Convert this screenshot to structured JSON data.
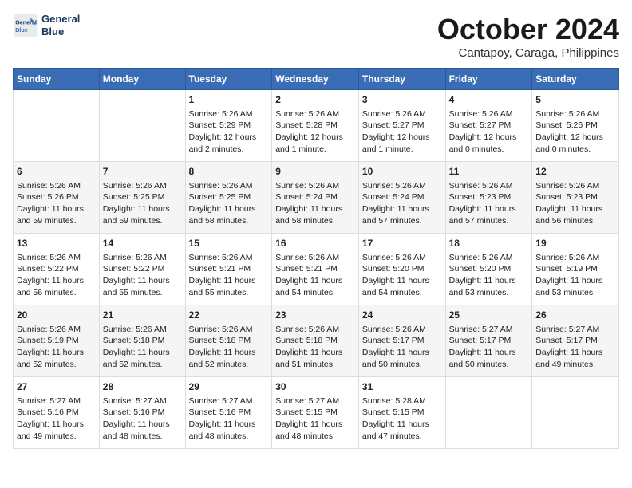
{
  "header": {
    "logo_line1": "General",
    "logo_line2": "Blue",
    "month_title": "October 2024",
    "location": "Cantapoy, Caraga, Philippines"
  },
  "days_of_week": [
    "Sunday",
    "Monday",
    "Tuesday",
    "Wednesday",
    "Thursday",
    "Friday",
    "Saturday"
  ],
  "weeks": [
    [
      {
        "day": "",
        "content": ""
      },
      {
        "day": "",
        "content": ""
      },
      {
        "day": "1",
        "content": "Sunrise: 5:26 AM\nSunset: 5:29 PM\nDaylight: 12 hours\nand 2 minutes."
      },
      {
        "day": "2",
        "content": "Sunrise: 5:26 AM\nSunset: 5:28 PM\nDaylight: 12 hours\nand 1 minute."
      },
      {
        "day": "3",
        "content": "Sunrise: 5:26 AM\nSunset: 5:27 PM\nDaylight: 12 hours\nand 1 minute."
      },
      {
        "day": "4",
        "content": "Sunrise: 5:26 AM\nSunset: 5:27 PM\nDaylight: 12 hours\nand 0 minutes."
      },
      {
        "day": "5",
        "content": "Sunrise: 5:26 AM\nSunset: 5:26 PM\nDaylight: 12 hours\nand 0 minutes."
      }
    ],
    [
      {
        "day": "6",
        "content": "Sunrise: 5:26 AM\nSunset: 5:26 PM\nDaylight: 11 hours\nand 59 minutes."
      },
      {
        "day": "7",
        "content": "Sunrise: 5:26 AM\nSunset: 5:25 PM\nDaylight: 11 hours\nand 59 minutes."
      },
      {
        "day": "8",
        "content": "Sunrise: 5:26 AM\nSunset: 5:25 PM\nDaylight: 11 hours\nand 58 minutes."
      },
      {
        "day": "9",
        "content": "Sunrise: 5:26 AM\nSunset: 5:24 PM\nDaylight: 11 hours\nand 58 minutes."
      },
      {
        "day": "10",
        "content": "Sunrise: 5:26 AM\nSunset: 5:24 PM\nDaylight: 11 hours\nand 57 minutes."
      },
      {
        "day": "11",
        "content": "Sunrise: 5:26 AM\nSunset: 5:23 PM\nDaylight: 11 hours\nand 57 minutes."
      },
      {
        "day": "12",
        "content": "Sunrise: 5:26 AM\nSunset: 5:23 PM\nDaylight: 11 hours\nand 56 minutes."
      }
    ],
    [
      {
        "day": "13",
        "content": "Sunrise: 5:26 AM\nSunset: 5:22 PM\nDaylight: 11 hours\nand 56 minutes."
      },
      {
        "day": "14",
        "content": "Sunrise: 5:26 AM\nSunset: 5:22 PM\nDaylight: 11 hours\nand 55 minutes."
      },
      {
        "day": "15",
        "content": "Sunrise: 5:26 AM\nSunset: 5:21 PM\nDaylight: 11 hours\nand 55 minutes."
      },
      {
        "day": "16",
        "content": "Sunrise: 5:26 AM\nSunset: 5:21 PM\nDaylight: 11 hours\nand 54 minutes."
      },
      {
        "day": "17",
        "content": "Sunrise: 5:26 AM\nSunset: 5:20 PM\nDaylight: 11 hours\nand 54 minutes."
      },
      {
        "day": "18",
        "content": "Sunrise: 5:26 AM\nSunset: 5:20 PM\nDaylight: 11 hours\nand 53 minutes."
      },
      {
        "day": "19",
        "content": "Sunrise: 5:26 AM\nSunset: 5:19 PM\nDaylight: 11 hours\nand 53 minutes."
      }
    ],
    [
      {
        "day": "20",
        "content": "Sunrise: 5:26 AM\nSunset: 5:19 PM\nDaylight: 11 hours\nand 52 minutes."
      },
      {
        "day": "21",
        "content": "Sunrise: 5:26 AM\nSunset: 5:18 PM\nDaylight: 11 hours\nand 52 minutes."
      },
      {
        "day": "22",
        "content": "Sunrise: 5:26 AM\nSunset: 5:18 PM\nDaylight: 11 hours\nand 52 minutes."
      },
      {
        "day": "23",
        "content": "Sunrise: 5:26 AM\nSunset: 5:18 PM\nDaylight: 11 hours\nand 51 minutes."
      },
      {
        "day": "24",
        "content": "Sunrise: 5:26 AM\nSunset: 5:17 PM\nDaylight: 11 hours\nand 50 minutes."
      },
      {
        "day": "25",
        "content": "Sunrise: 5:27 AM\nSunset: 5:17 PM\nDaylight: 11 hours\nand 50 minutes."
      },
      {
        "day": "26",
        "content": "Sunrise: 5:27 AM\nSunset: 5:17 PM\nDaylight: 11 hours\nand 49 minutes."
      }
    ],
    [
      {
        "day": "27",
        "content": "Sunrise: 5:27 AM\nSunset: 5:16 PM\nDaylight: 11 hours\nand 49 minutes."
      },
      {
        "day": "28",
        "content": "Sunrise: 5:27 AM\nSunset: 5:16 PM\nDaylight: 11 hours\nand 48 minutes."
      },
      {
        "day": "29",
        "content": "Sunrise: 5:27 AM\nSunset: 5:16 PM\nDaylight: 11 hours\nand 48 minutes."
      },
      {
        "day": "30",
        "content": "Sunrise: 5:27 AM\nSunset: 5:15 PM\nDaylight: 11 hours\nand 48 minutes."
      },
      {
        "day": "31",
        "content": "Sunrise: 5:28 AM\nSunset: 5:15 PM\nDaylight: 11 hours\nand 47 minutes."
      },
      {
        "day": "",
        "content": ""
      },
      {
        "day": "",
        "content": ""
      }
    ]
  ]
}
